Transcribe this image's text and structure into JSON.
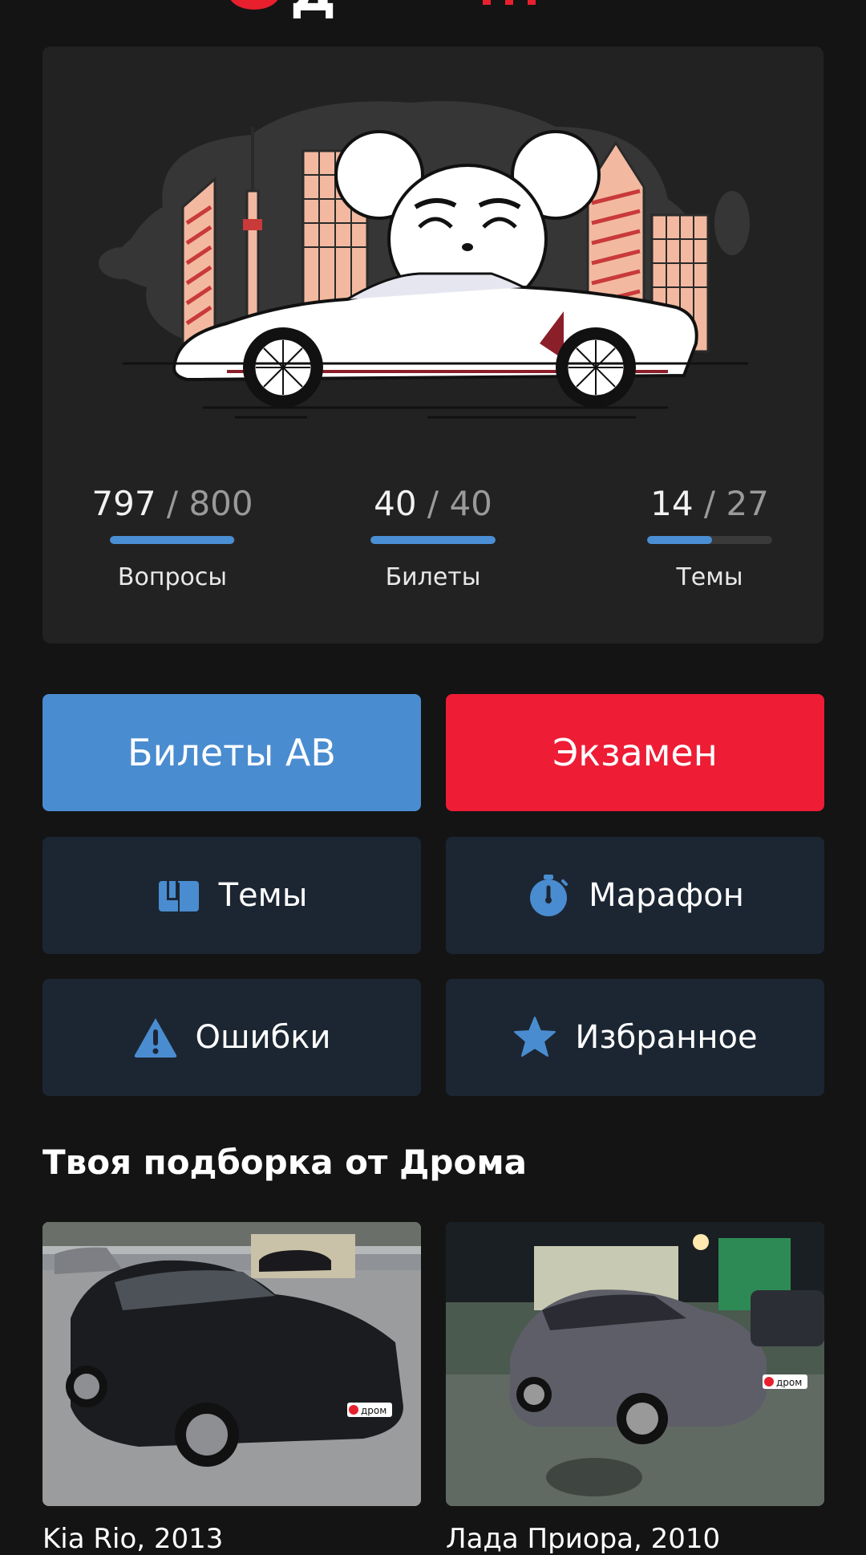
{
  "header": {
    "brand_color": "#e8202e"
  },
  "hero": {
    "illustration": "mouse-driving-sports-car-city"
  },
  "stats": [
    {
      "current": "797",
      "separator": "/",
      "total": "800",
      "label": "Вопросы",
      "progress": 0.996
    },
    {
      "current": "40",
      "separator": "/",
      "total": "40",
      "label": "Билеты",
      "progress": 1.0
    },
    {
      "current": "14",
      "separator": "/",
      "total": "27",
      "label": "Темы",
      "progress": 0.52
    }
  ],
  "actions": {
    "tickets_label": "Билеты АВ",
    "exam_label": "Экзамен",
    "topics_label": "Темы",
    "marathon_label": "Марафон",
    "mistakes_label": "Ошибки",
    "favorites_label": "Избранное"
  },
  "colors": {
    "accent_blue": "#4a8cd0",
    "accent_red": "#ee1c35",
    "dark_button": "#1c2633",
    "icon_blue": "#4a8cd0"
  },
  "recommendations": {
    "title": "Твоя подборка от Дрома",
    "cars": [
      {
        "caption": "Kia Rio, 2013",
        "image": "black-sedan-photo",
        "badge": "дром"
      },
      {
        "caption": "Лада Приора, 2010",
        "image": "grey-sedan-night-photo",
        "badge": "дром"
      }
    ]
  }
}
